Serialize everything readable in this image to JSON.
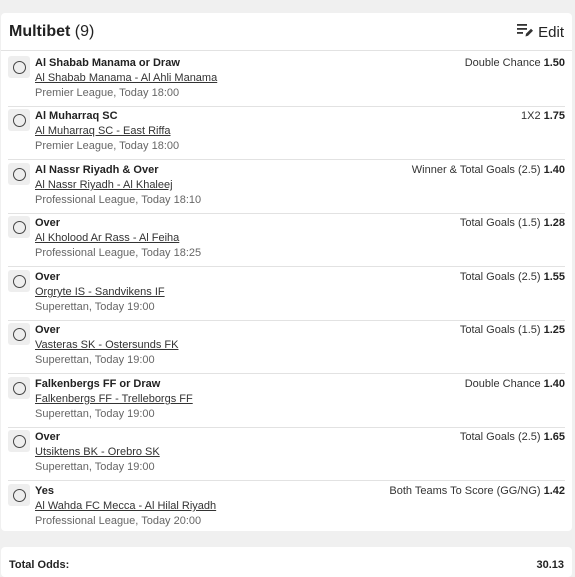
{
  "header": {
    "title": "Multibet",
    "count": "(9)",
    "edit_label": "Edit"
  },
  "bets": [
    {
      "selection": "Al Shabab Manama or Draw",
      "match": "Al Shabab Manama - Al Ahli Manama",
      "league": "Premier League, Today 18:00",
      "market": "Double Chance",
      "odds": "1.50"
    },
    {
      "selection": "Al Muharraq SC",
      "match": "Al Muharraq SC - East Riffa",
      "league": "Premier League, Today 18:00",
      "market": "1X2",
      "odds": "1.75"
    },
    {
      "selection": "Al Nassr Riyadh & Over",
      "match": "Al Nassr Riyadh - Al Khaleej",
      "league": "Professional League, Today 18:10",
      "market": "Winner & Total Goals (2.5)",
      "odds": "1.40"
    },
    {
      "selection": "Over",
      "match": "Al Kholood Ar Rass - Al Feiha",
      "league": "Professional League, Today 18:25",
      "market": "Total Goals (1.5)",
      "odds": "1.28"
    },
    {
      "selection": "Over",
      "match": "Orgryte IS - Sandvikens IF",
      "league": "Superettan, Today 19:00",
      "market": "Total Goals (2.5)",
      "odds": "1.55"
    },
    {
      "selection": "Over",
      "match": "Vasteras SK - Ostersunds FK",
      "league": "Superettan, Today 19:00",
      "market": "Total Goals (1.5)",
      "odds": "1.25"
    },
    {
      "selection": "Falkenbergs FF or Draw",
      "match": "Falkenbergs FF - Trelleborgs FF",
      "league": "Superettan, Today 19:00",
      "market": "Double Chance",
      "odds": "1.40"
    },
    {
      "selection": "Over",
      "match": "Utsiktens BK - Orebro SK",
      "league": "Superettan, Today 19:00",
      "market": "Total Goals (2.5)",
      "odds": "1.65"
    },
    {
      "selection": "Yes",
      "match": "Al Wahda FC Mecca - Al Hilal Riyadh",
      "league": "Professional League, Today 20:00",
      "market": "Both Teams To Score (GG/NG)",
      "odds": "1.42"
    }
  ],
  "totals": {
    "label": "Total Odds:",
    "value": "30.13"
  }
}
